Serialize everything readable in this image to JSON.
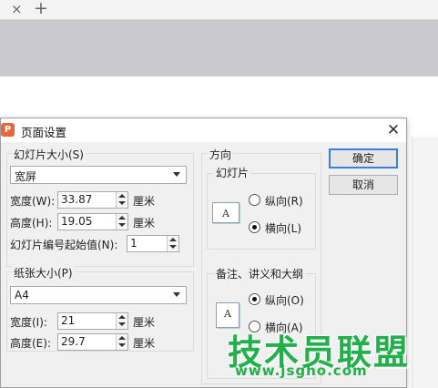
{
  "browser": {
    "close_glyph": "×",
    "new_tab_glyph": "+"
  },
  "dialog": {
    "title": "页面设置",
    "app_icon_letter": "P",
    "close_glyph": "✕",
    "slide_size": {
      "label": "幻灯片大小(S)",
      "selected": "宽屏",
      "width_label": "宽度(W):",
      "width_value": "33.87",
      "height_label": "高度(H):",
      "height_value": "19.05",
      "unit": "厘米",
      "start_label": "幻灯片编号起始值(N):",
      "start_value": "1"
    },
    "paper_size": {
      "label": "纸张大小(P)",
      "selected": "A4",
      "width_label": "宽度(I):",
      "width_value": "21",
      "height_label": "高度(E):",
      "height_value": "29.7",
      "unit": "厘米"
    },
    "orientation": {
      "label": "方向",
      "slides_label": "幻灯片",
      "slides_portrait": "纵向(R)",
      "slides_landscape": "横向(L)",
      "notes_label": "备注、讲义和大纲",
      "notes_portrait": "纵向(O)",
      "notes_landscape": "横向(A)",
      "icon_letter": "A"
    },
    "ok_label": "确定",
    "cancel_label": "取消"
  },
  "watermark": {
    "text": "技术员联盟",
    "url": "www.jsgho.com"
  },
  "colors": {
    "accent": "#3c7fd6",
    "watermark": "#22b04a",
    "app_icon": "#e8663c"
  }
}
